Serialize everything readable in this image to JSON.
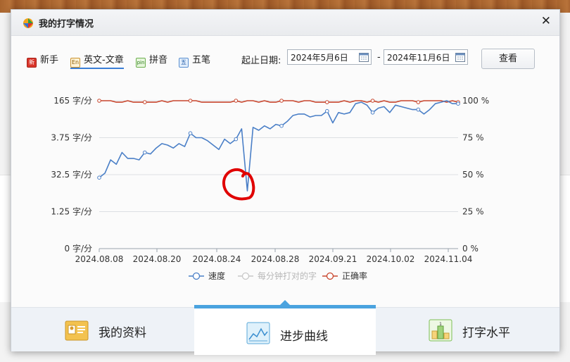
{
  "window": {
    "title": "我的打字情况"
  },
  "tabs": [
    {
      "icon": "新",
      "label": "新手"
    },
    {
      "icon": "En",
      "label": "英文-文章",
      "active": true
    },
    {
      "icon": "pin",
      "label": "拼音"
    },
    {
      "icon": "五",
      "label": "五笔"
    }
  ],
  "date_filter": {
    "label": "起止日期:",
    "start": "2024年5月6日",
    "separator": "-",
    "end": "2024年11月6日",
    "button": "查看"
  },
  "legend": [
    "速度",
    "每分钟打对的字",
    "正确率"
  ],
  "bottom_tabs": [
    {
      "label": "我的资料"
    },
    {
      "label": "进步曲线",
      "active": true
    },
    {
      "label": "打字水平"
    }
  ],
  "colors": {
    "speed": "#4a7fc7",
    "correct_per_min": "#c8c8c8",
    "accuracy": "#c8452c",
    "annotation": "#e00000"
  },
  "chart_data": {
    "type": "line",
    "x_tick_labels": [
      "2024.08.08",
      "2024.08.20",
      "2024.08.24",
      "2024.08.28",
      "2024.09.21",
      "2024.10.02",
      "2024.11.04"
    ],
    "y_left_tick_labels": [
      "0 字/分",
      "1.25 字/分",
      "32.5 字/分",
      "3.75 字/分",
      "165 字/分"
    ],
    "y_right_tick_labels": [
      "0 %",
      "25 %",
      "50 %",
      "75 %",
      "100 %"
    ],
    "grid": true,
    "legend_position": "bottom",
    "series": [
      {
        "name": "速度",
        "axis": "left",
        "values": [
          48,
          51,
          60,
          57,
          65,
          61,
          61,
          60,
          65,
          64,
          68,
          71,
          70,
          68,
          71,
          69,
          78,
          75,
          75,
          73,
          70,
          67,
          74,
          71,
          74,
          81,
          39,
          82,
          80,
          83,
          81,
          84,
          83,
          86,
          90,
          91,
          91,
          89,
          90,
          90,
          93,
          85,
          92,
          91,
          92,
          98,
          99,
          97,
          92,
          95,
          96,
          92,
          97,
          96,
          95,
          94,
          94,
          91,
          94,
          98,
          99,
          100,
          98,
          98
        ]
      },
      {
        "name": "每分钟打对的字",
        "axis": "left",
        "values": []
      },
      {
        "name": "正确率",
        "axis": "right",
        "values": [
          100,
          100,
          100,
          99,
          99,
          100,
          99,
          99,
          99,
          99,
          99,
          100,
          99,
          100,
          100,
          100,
          100,
          100,
          99,
          99,
          99,
          99,
          99,
          99,
          100,
          99,
          100,
          100,
          99,
          100,
          99,
          99,
          100,
          100,
          100,
          99,
          100,
          100,
          99,
          99,
          99,
          99,
          99,
          100,
          99,
          100,
          100,
          99,
          100,
          99,
          100,
          99,
          99,
          100,
          100,
          100,
          99,
          100,
          100,
          100,
          100,
          99,
          100,
          99
        ]
      }
    ],
    "y_right_range": [
      0,
      100
    ]
  }
}
